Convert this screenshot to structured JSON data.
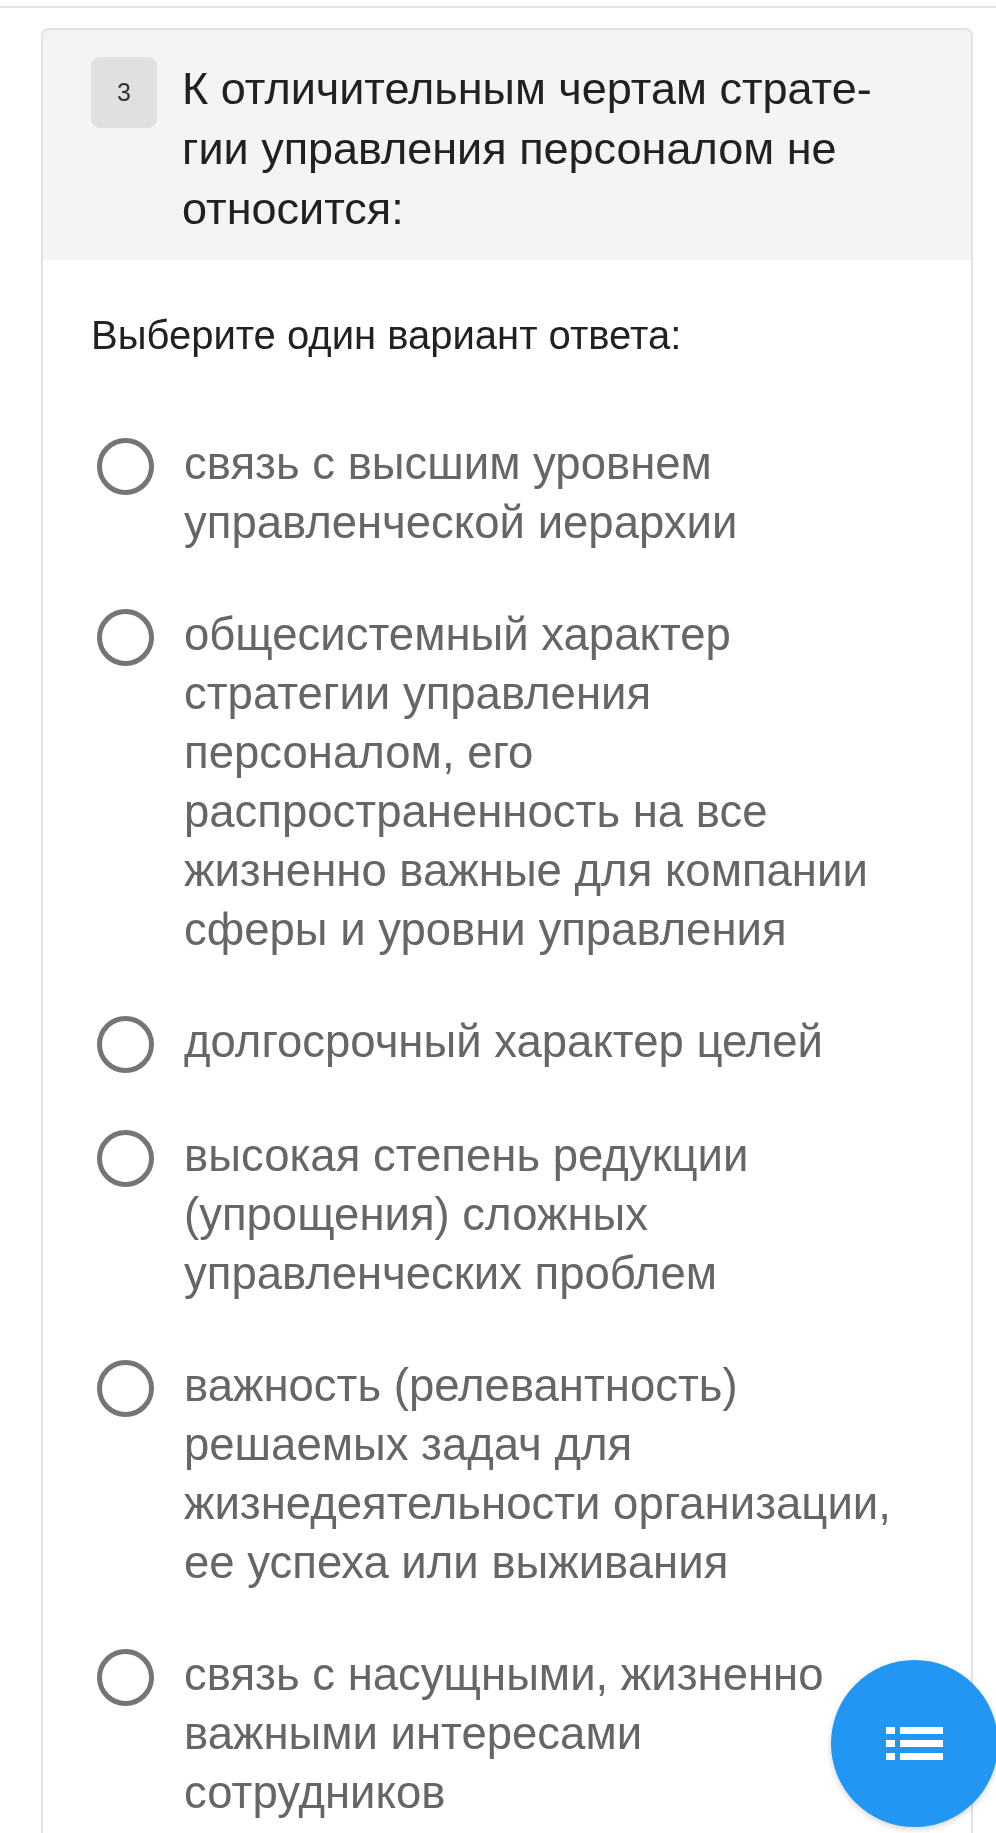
{
  "question": {
    "number": "3",
    "text": "К отличительным чертам страте-гии управления персоналом не относится:"
  },
  "instruction": "Выберите один вариант ответа:",
  "options": [
    {
      "label": "связь с высшим уровнем управленческой иерархии",
      "selected": false
    },
    {
      "label": "общесистемный характер стратегии управления персоналом, его распространенность на все жизненно важные для компании сферы и уровни управления",
      "selected": false
    },
    {
      "label": "долгосрочный характер целей",
      "selected": false
    },
    {
      "label": "высокая степень редукции (упрощения) сложных управленческих проблем",
      "selected": false
    },
    {
      "label": "важность (релевантность) решаемых задач для жизнедеятельности организации, ее успеха или выживания",
      "selected": false
    },
    {
      "label": "связь с насущными, жизненно важными интересами сотрудников",
      "selected": false
    }
  ]
}
